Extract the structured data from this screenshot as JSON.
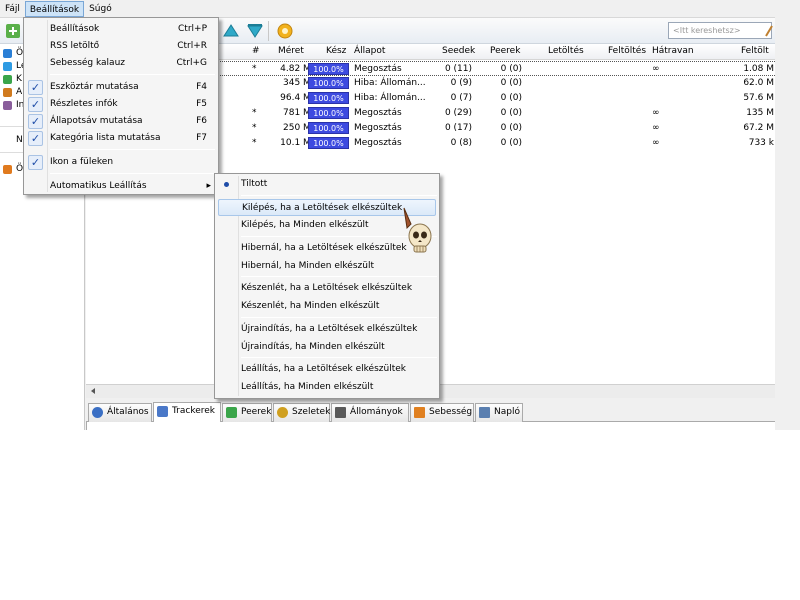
{
  "menubar": {
    "items": [
      {
        "label": "Fájl"
      },
      {
        "label": "Beállítások"
      },
      {
        "label": "Súgó"
      }
    ]
  },
  "search": {
    "placeholder": "<Itt kereshetsz>"
  },
  "sidebar": {
    "items": [
      {
        "label": "Ö",
        "color": "#2a7fd6"
      },
      {
        "label": "Le",
        "color": "#2e9be3"
      },
      {
        "label": "K",
        "color": "#3aa54a"
      },
      {
        "label": "A",
        "color": "#d07a1e"
      },
      {
        "label": "In",
        "color": "#8a5e9c"
      },
      {
        "label": "N",
        "color": ""
      },
      {
        "label": "Ö",
        "color": "#e07a1e"
      }
    ]
  },
  "table": {
    "columns": [
      "#",
      "Méret",
      "Kész",
      "Állapot",
      "Seedek",
      "Peerek",
      "Letöltés",
      "Feltöltés",
      "Hátravan",
      "Feltölt"
    ],
    "rows": [
      {
        "num": "*",
        "size": "4.82 MB",
        "done": "100.0%",
        "status": "Megosztás",
        "seeds": "0 (11)",
        "peers": "0 (0)",
        "remaining": "∞",
        "uploaded": "1.08 M"
      },
      {
        "num": "",
        "size": "345 MB",
        "done": "100.0%",
        "status": "Hiba: Állomán...",
        "seeds": "0 (9)",
        "peers": "0 (0)",
        "remaining": "",
        "uploaded": "62.0 M"
      },
      {
        "num": "",
        "size": "96.4 MB",
        "done": "100.0%",
        "status": "Hiba: Állomán...",
        "seeds": "0 (7)",
        "peers": "0 (0)",
        "remaining": "",
        "uploaded": "57.6 M"
      },
      {
        "num": "*",
        "size": "781 MB",
        "done": "100.0%",
        "status": "Megosztás",
        "seeds": "0 (29)",
        "peers": "0 (0)",
        "remaining": "∞",
        "uploaded": "135 M"
      },
      {
        "num": "*",
        "size": "250 MB",
        "done": "100.0%",
        "status": "Megosztás",
        "seeds": "0 (17)",
        "peers": "0 (0)",
        "remaining": "∞",
        "uploaded": "67.2 M"
      },
      {
        "num": "*",
        "size": "10.1 MB",
        "done": "100.0%",
        "status": "Megosztás",
        "seeds": "0 (8)",
        "peers": "0 (0)",
        "remaining": "∞",
        "uploaded": "733 k"
      }
    ]
  },
  "tabs": [
    {
      "label": "Általános",
      "icon": "info-icon",
      "color": "#3a6fc4"
    },
    {
      "label": "Trackerek",
      "icon": "trackers-icon",
      "color": "#4a78c8"
    },
    {
      "label": "Peerek",
      "icon": "peers-icon",
      "color": "#3aa54a"
    },
    {
      "label": "Szeletek",
      "icon": "pieces-icon",
      "color": "#d0a020"
    },
    {
      "label": "Állományok",
      "icon": "files-icon",
      "color": "#5a5a5a"
    },
    {
      "label": "Sebesség",
      "icon": "speed-icon",
      "color": "#e08020"
    },
    {
      "label": "Napló",
      "icon": "log-icon",
      "color": "#5a7fb0"
    }
  ],
  "settings_menu": {
    "items": [
      {
        "label": "Beállítások",
        "shortcut": "Ctrl+P",
        "checked": false
      },
      {
        "label": "RSS letöltő",
        "shortcut": "Ctrl+R",
        "checked": false
      },
      {
        "label": "Sebesség kalauz",
        "shortcut": "Ctrl+G",
        "checked": false
      },
      {
        "label": "Eszköztár mutatása",
        "shortcut": "F4",
        "checked": true
      },
      {
        "label": "Részletes infók",
        "shortcut": "F5",
        "checked": true
      },
      {
        "label": "Állapotsáv mutatása",
        "shortcut": "F6",
        "checked": true
      },
      {
        "label": "Kategória lista mutatása",
        "shortcut": "F7",
        "checked": true
      },
      {
        "label": "Ikon a füleken",
        "shortcut": "",
        "checked": true
      },
      {
        "label": "Automatikus Leállítás",
        "shortcut": "",
        "checked": false
      }
    ]
  },
  "autostop_menu": {
    "items": [
      {
        "label": "Tiltott",
        "selected": true
      },
      {
        "label": "Kilépés, ha a Letöltések elkészültek",
        "highlighted": true
      },
      {
        "label": "Kilépés, ha Minden elkészült"
      },
      {
        "label": "Hibernál, ha a Letöltések elkészültek"
      },
      {
        "label": "Hibernál, ha Minden elkészült"
      },
      {
        "label": "Készenlét, ha a Letöltések elkészültek"
      },
      {
        "label": "Készenlét, ha Minden elkészült"
      },
      {
        "label": "Újraindítás, ha a Letöltések elkészültek"
      },
      {
        "label": "Újraindítás, ha Minden elkészült"
      },
      {
        "label": "Leállítás, ha a Letöltések elkészültek"
      },
      {
        "label": "Leállítás, ha Minden elkészült"
      }
    ]
  },
  "cursor": {
    "icon": "skull-cursor-icon"
  }
}
